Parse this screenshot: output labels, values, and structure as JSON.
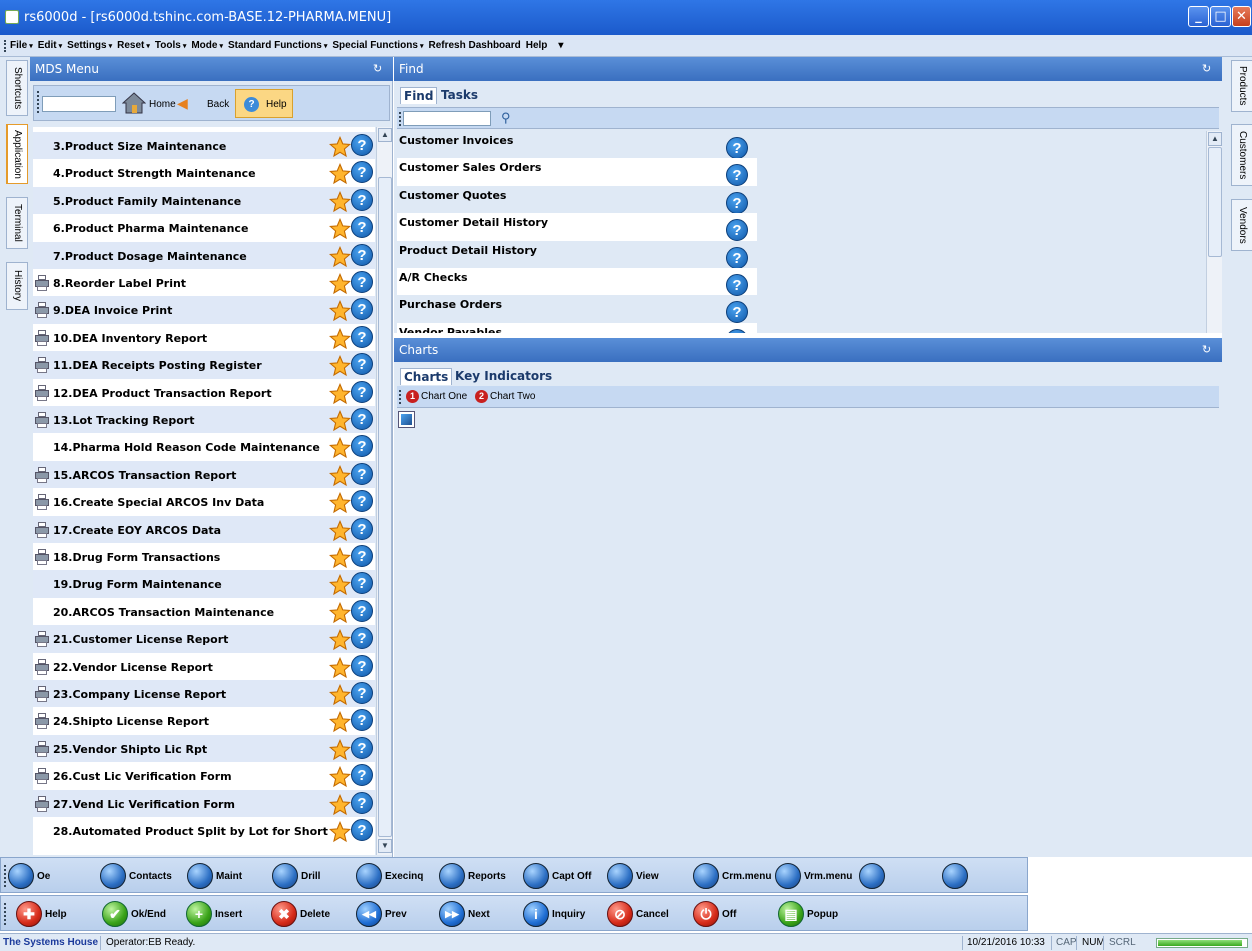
{
  "window": {
    "title": "rs6000d - [rs6000d.tshinc.com-BASE.12-PHARMA.MENU]",
    "controls": {
      "minimize": "_",
      "maximize": "□",
      "close": "✕"
    }
  },
  "menubar": {
    "items": [
      {
        "label": "File",
        "has_arrow": true
      },
      {
        "label": "Edit",
        "has_arrow": true
      },
      {
        "label": "Settings",
        "has_arrow": true
      },
      {
        "label": "Reset",
        "has_arrow": true
      },
      {
        "label": "Tools",
        "has_arrow": true
      },
      {
        "label": "Mode",
        "has_arrow": true
      },
      {
        "label": "Standard Functions",
        "has_arrow": true
      },
      {
        "label": "Special Functions",
        "has_arrow": true
      },
      {
        "label": "Refresh Dashboard",
        "has_arrow": false
      },
      {
        "label": "Help",
        "has_arrow": false
      }
    ],
    "overflow": "▾",
    "arrow": "▾"
  },
  "left_tabs": [
    "Shortcuts",
    "Application",
    "Terminal",
    "History"
  ],
  "right_tabs": [
    "Products",
    "Customers",
    "Vendors"
  ],
  "mds": {
    "title": "MDS Menu",
    "pin": "↻",
    "search_value": "",
    "home_label": "Home",
    "back_label": "Back",
    "help_label": "Help",
    "items": [
      {
        "label": "3.Product Size Maintenance",
        "printer": false
      },
      {
        "label": "4.Product Strength Maintenance",
        "printer": false
      },
      {
        "label": "5.Product Family Maintenance",
        "printer": false
      },
      {
        "label": "6.Product Pharma Maintenance",
        "printer": false
      },
      {
        "label": "7.Product Dosage Maintenance",
        "printer": false
      },
      {
        "label": "8.Reorder Label Print",
        "printer": true
      },
      {
        "label": "9.DEA Invoice Print",
        "printer": true
      },
      {
        "label": "10.DEA Inventory Report",
        "printer": true
      },
      {
        "label": "11.DEA Receipts Posting Register",
        "printer": true
      },
      {
        "label": "12.DEA Product Transaction Report",
        "printer": true
      },
      {
        "label": "13.Lot Tracking Report",
        "printer": true
      },
      {
        "label": "14.Pharma Hold Reason Code Maintenance",
        "printer": false
      },
      {
        "label": "15.ARCOS Transaction Report",
        "printer": true
      },
      {
        "label": "16.Create Special ARCOS Inv Data",
        "printer": true
      },
      {
        "label": "17.Create EOY ARCOS Data",
        "printer": true
      },
      {
        "label": "18.Drug Form Transactions",
        "printer": true
      },
      {
        "label": "19.Drug Form Maintenance",
        "printer": false
      },
      {
        "label": "20.ARCOS Transaction Maintenance",
        "printer": false
      },
      {
        "label": "21.Customer License Report",
        "printer": true
      },
      {
        "label": "22.Vendor License Report",
        "printer": true
      },
      {
        "label": "23.Company License Report",
        "printer": true
      },
      {
        "label": "24.Shipto License Report",
        "printer": true
      },
      {
        "label": "25.Vendor Shipto Lic Rpt",
        "printer": true
      },
      {
        "label": "26.Cust Lic Verification Form",
        "printer": true
      },
      {
        "label": "27.Vend Lic Verification Form",
        "printer": true
      },
      {
        "label": "28.Automated Product Split by Lot for Short ...",
        "printer": false
      }
    ]
  },
  "find": {
    "title": "Find",
    "pin": "↻",
    "tabs": [
      "Find",
      "Tasks"
    ],
    "search_value": "",
    "items": [
      "Customer Invoices",
      "Customer Sales Orders",
      "Customer Quotes",
      "Customer Detail History",
      "Product Detail History",
      "A/R Checks",
      "Purchase Orders",
      "Vendor Payables"
    ]
  },
  "charts": {
    "title": "Charts",
    "pin": "↻",
    "tabs": [
      "Charts",
      "Key Indicators"
    ],
    "chart_buttons": [
      {
        "num": "1",
        "label": "Chart One"
      },
      {
        "num": "2",
        "label": "Chart Two"
      }
    ]
  },
  "cmdbar1": [
    "Oe",
    "Contacts",
    "Maint",
    "Drill",
    "Execinq",
    "Reports",
    "Capt Off",
    "View",
    "Crm.menu",
    "Vrm.menu",
    "",
    ""
  ],
  "cmdbar2": [
    {
      "label": "Help",
      "icon": "help-ring-icon",
      "color": "red",
      "glyph": "✚"
    },
    {
      "label": "Ok/End",
      "icon": "check-icon",
      "color": "green",
      "glyph": "✔"
    },
    {
      "label": "Insert",
      "icon": "plus-icon",
      "color": "green",
      "glyph": "+"
    },
    {
      "label": "Delete",
      "icon": "x-icon",
      "color": "red",
      "glyph": "✖"
    },
    {
      "label": "Prev",
      "icon": "prev-icon",
      "color": "blue",
      "glyph": "◀◀"
    },
    {
      "label": "Next",
      "icon": "next-icon",
      "color": "blue",
      "glyph": "▶▶"
    },
    {
      "label": "Inquiry",
      "icon": "info-icon",
      "color": "blue",
      "glyph": "i"
    },
    {
      "label": "Cancel",
      "icon": "cancel-icon",
      "color": "red",
      "glyph": "⊘"
    },
    {
      "label": "Off",
      "icon": "power-icon",
      "color": "red",
      "glyph": "⏻"
    },
    {
      "label": "Popup",
      "icon": "popup-icon",
      "color": "green",
      "glyph": "▤"
    }
  ],
  "status": {
    "company": "The Systems House",
    "operator": "Operator:EB Ready.",
    "datetime": "10/21/2016 10:33",
    "cap": "CAP",
    "num": "NUM",
    "scrl": "SCRL",
    "progress_fraction": 0.95
  },
  "colors": {
    "titlebar": "#2a6ad9",
    "panel_header": "#4a80cc",
    "row_alt": "#dfe8f7",
    "help_highlight": "#fbd784"
  }
}
